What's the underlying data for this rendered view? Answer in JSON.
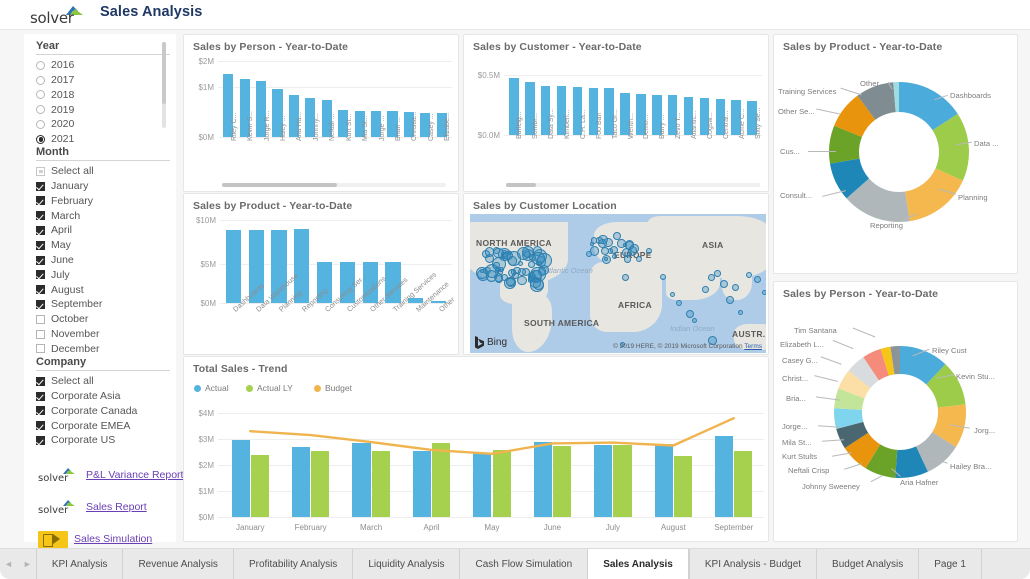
{
  "header": {
    "logo_text": "solver",
    "title": "Sales Analysis"
  },
  "filters": {
    "year": {
      "title": "Year",
      "options": [
        {
          "label": "2016",
          "selected": false
        },
        {
          "label": "2017",
          "selected": false
        },
        {
          "label": "2018",
          "selected": false
        },
        {
          "label": "2019",
          "selected": false
        },
        {
          "label": "2020",
          "selected": false
        },
        {
          "label": "2021",
          "selected": true
        }
      ]
    },
    "month": {
      "title": "Month",
      "options": [
        {
          "label": "Select all",
          "state": "partial"
        },
        {
          "label": "January",
          "state": "checked"
        },
        {
          "label": "February",
          "state": "checked"
        },
        {
          "label": "March",
          "state": "checked"
        },
        {
          "label": "April",
          "state": "checked"
        },
        {
          "label": "May",
          "state": "checked"
        },
        {
          "label": "June",
          "state": "checked"
        },
        {
          "label": "July",
          "state": "checked"
        },
        {
          "label": "August",
          "state": "checked"
        },
        {
          "label": "September",
          "state": "checked"
        },
        {
          "label": "October",
          "state": "unchecked"
        },
        {
          "label": "November",
          "state": "unchecked"
        },
        {
          "label": "December",
          "state": "unchecked"
        }
      ]
    },
    "company": {
      "title": "Company",
      "options": [
        {
          "label": "Select all",
          "state": "checked"
        },
        {
          "label": "Corporate Asia",
          "state": "checked"
        },
        {
          "label": "Corporate Canada",
          "state": "checked"
        },
        {
          "label": "Corporate EMEA",
          "state": "checked"
        },
        {
          "label": "Corporate US",
          "state": "checked"
        }
      ]
    },
    "links": [
      {
        "label": "P&L Variance Report",
        "icon": "solver-logo"
      },
      {
        "label": "Sales Report",
        "icon": "solver-logo"
      },
      {
        "label": "Sales Simulation",
        "icon": "simulation-icon"
      }
    ]
  },
  "chart_data": [
    {
      "id": "sales_by_person_bar",
      "type": "bar",
      "title": "Sales by Person  - Year-to-Date",
      "ylabel": "",
      "xlabel": "",
      "yticks": [
        "$0M",
        "$1M",
        "$2M"
      ],
      "ylim": [
        0,
        2000000
      ],
      "color": "#55b3e0",
      "categories": [
        "Riley C...",
        "Kevin S...",
        "Jorge R...",
        "Haley ...",
        "Aria Ha...",
        "Johnny...",
        "Neftali ...",
        "Kurt St...",
        "Mia St...",
        "Jorge ...",
        "Brian ...",
        "Christia...",
        "Casey ...",
        "Elizabe..."
      ],
      "values": [
        1620000,
        1480000,
        1430000,
        1230000,
        1080000,
        1010000,
        940000,
        680000,
        670000,
        665000,
        655000,
        645000,
        625000,
        615000
      ]
    },
    {
      "id": "sales_by_customer_bar",
      "type": "bar",
      "title": "Sales by Customer - Year-to-Date",
      "yticks": [
        "$0.0M",
        "$0.5M"
      ],
      "ylim": [
        0,
        500000
      ],
      "color": "#55b3e0",
      "categories": [
        "Burleig...",
        "Sombr...",
        "Data Sy...",
        "Kimberl...",
        "C.H. La...",
        "Foo Ban",
        "Taco Gr...",
        "Wenth...",
        "Demo...",
        "Barry ...",
        "Zevo T...",
        "Atlantic...",
        "Cogsw...",
        "Central...",
        "Acme C...",
        "Sixty Se..."
      ],
      "values": [
        456000,
        430000,
        398000,
        392000,
        385000,
        380000,
        378000,
        342000,
        327000,
        322000,
        320000,
        310000,
        300000,
        292000,
        285000,
        278000
      ]
    },
    {
      "id": "sales_by_product_bar",
      "type": "bar",
      "title": "Sales by Product - Year-to-Date",
      "yticks": [
        "$0M",
        "$5M",
        "$10M"
      ],
      "ylim": [
        0,
        10000000
      ],
      "color": "#55b3e0",
      "categories": [
        "Dashboards",
        "Data Warehouse",
        "Planning",
        "Reporting",
        "Consulting Ser...",
        "Customizations",
        "Other Services",
        "Training Services",
        "Maintenance",
        "Other"
      ],
      "values": [
        8600000,
        8600000,
        8600000,
        8650000,
        4800000,
        4780000,
        4780000,
        4780000,
        620000,
        260000
      ]
    },
    {
      "id": "sales_by_product_donut",
      "type": "pie",
      "title": "Sales by Product - Year-to-Date",
      "legend": "labels-around",
      "labels": [
        "Dashboards",
        "Data ...",
        "Planning",
        "Reporting",
        "Consult...",
        "Cus...",
        "Other Se...",
        "Training Services",
        "Other"
      ],
      "values": [
        16.8,
        16.8,
        16.8,
        16.9,
        9.4,
        9.3,
        9.3,
        9.3,
        1.4
      ],
      "colors": [
        "#4bacdb",
        "#9dcc4a",
        "#f5b84f",
        "#b0b7bb",
        "#1f87b8",
        "#6aa328",
        "#e8940c",
        "#7f8c91",
        "#9fdbe0"
      ]
    },
    {
      "id": "sales_by_person_donut",
      "type": "pie",
      "title": "Sales by Person  - Year-to-Date",
      "legend": "labels-around",
      "labels": [
        "Riley Cust",
        "Kevin Stu...",
        "Jorg...",
        "Hailey Bra...",
        "Aria Hafner",
        "Johnny Sweeney",
        "Neftali Crisp",
        "Kurt Stults",
        "Mila St...",
        "Jorge...",
        "Bria...",
        "Christ...",
        "Casey G...",
        "Elizabeth L...",
        "Tim Santana"
      ],
      "values": [
        11.5,
        10.5,
        10.2,
        8.7,
        7.7,
        7.2,
        6.7,
        4.8,
        4.8,
        4.7,
        4.7,
        4.6,
        4.4,
        2.3,
        2.2
      ],
      "colors": [
        "#4bacdb",
        "#9dcc4a",
        "#f5b84f",
        "#b0b7bb",
        "#1f87b8",
        "#6aa328",
        "#e8940c",
        "#4a6670",
        "#7fd4ee",
        "#c2e59a",
        "#fbdfa6",
        "#d8dcde",
        "#f58b7a",
        "#f5c518",
        "#8a9499"
      ]
    },
    {
      "id": "total_sales_trend",
      "type": "bar",
      "title": "Total Sales - Trend",
      "yticks": [
        "$0M",
        "$1M",
        "$2M",
        "$3M",
        "$4M"
      ],
      "ylim": [
        0,
        4000000
      ],
      "categories": [
        "January",
        "February",
        "March",
        "April",
        "May",
        "June",
        "July",
        "August",
        "September"
      ],
      "series": [
        {
          "name": "Actual",
          "color": "#55b3e0",
          "values": [
            2950000,
            2690000,
            2830000,
            2540000,
            2450000,
            2880000,
            2770000,
            2820000,
            3130000
          ]
        },
        {
          "name": "Actual LY",
          "color": "#a5d14e",
          "values": [
            2400000,
            2520000,
            2530000,
            2830000,
            2560000,
            2730000,
            2760000,
            2340000,
            2520000
          ]
        },
        {
          "name": "Budget",
          "color": "#f0b44f",
          "type": "line",
          "values": [
            3300000,
            3150000,
            2880000,
            2580000,
            2430000,
            2830000,
            2860000,
            2750000,
            3800000
          ]
        }
      ]
    }
  ],
  "map": {
    "title": "Sales by Customer Location",
    "provider": "Bing",
    "continents": [
      "NORTH AMERICA",
      "EUROPE",
      "ASIA",
      "AFRICA",
      "SOUTH AMERICA",
      "AUSTR..."
    ],
    "oceans": [
      "Atlantic Ocean",
      "Indian Ocean"
    ],
    "attribution": "© 2019 HERE, © 2019 Microsoft Corporation",
    "terms_label": "Terms"
  },
  "tabs": {
    "prev_label": "◄",
    "next_label": "►",
    "items": [
      {
        "label": "KPI Analysis",
        "active": false
      },
      {
        "label": "Revenue Analysis",
        "active": false
      },
      {
        "label": "Profitability Analysis",
        "active": false
      },
      {
        "label": "Liquidity Analysis",
        "active": false
      },
      {
        "label": "Cash Flow Simulation",
        "active": false
      },
      {
        "label": "Sales Analysis",
        "active": true
      },
      {
        "label": "KPI Analysis - Budget",
        "active": false
      },
      {
        "label": "Budget Analysis",
        "active": false
      },
      {
        "label": "Page 1",
        "active": false
      }
    ]
  }
}
